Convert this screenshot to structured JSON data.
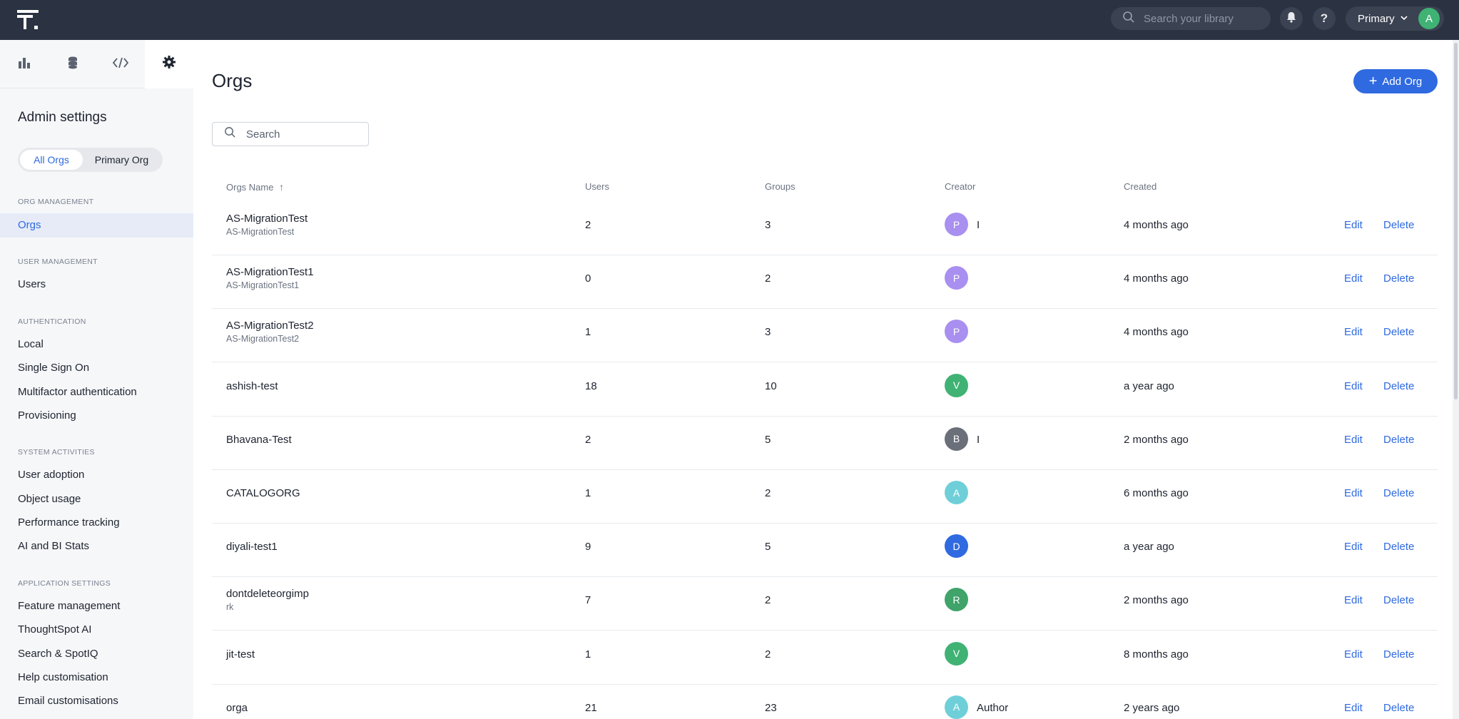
{
  "topbar": {
    "search_placeholder": "Search your library",
    "org_label": "Primary",
    "user_initial": "A",
    "help_label": "?"
  },
  "sidebar": {
    "title": "Admin settings",
    "segment": [
      "All Orgs",
      "Primary Org"
    ],
    "sections": [
      {
        "label": "ORG MANAGEMENT",
        "items": [
          "Orgs"
        ]
      },
      {
        "label": "USER MANAGEMENT",
        "items": [
          "Users"
        ]
      },
      {
        "label": "AUTHENTICATION",
        "items": [
          "Local",
          "Single Sign On",
          "Multifactor authentication",
          "Provisioning"
        ]
      },
      {
        "label": "SYSTEM ACTIVITIES",
        "items": [
          "User adoption",
          "Object usage",
          "Performance tracking",
          "AI and BI Stats"
        ]
      },
      {
        "label": "APPLICATION SETTINGS",
        "items": [
          "Feature management",
          "ThoughtSpot AI",
          "Search & SpotIQ",
          "Help customisation",
          "Email customisations"
        ]
      }
    ]
  },
  "main": {
    "title": "Orgs",
    "add_label": "Add Org",
    "search_placeholder": "Search",
    "columns": [
      "Orgs Name",
      "Users",
      "Groups",
      "Creator",
      "Created"
    ],
    "sort_indicator": "↑",
    "edit_label": "Edit",
    "delete_label": "Delete",
    "rows": [
      {
        "name": "AS-MigrationTest",
        "desc": "AS-MigrationTest",
        "users": "2",
        "groups": "3",
        "initial": "P",
        "color": "#a88ff0",
        "creator": "I",
        "created": "4 months ago"
      },
      {
        "name": "AS-MigrationTest1",
        "desc": "AS-MigrationTest1",
        "users": "0",
        "groups": "2",
        "initial": "P",
        "color": "#a88ff0",
        "creator": "",
        "created": "4 months ago"
      },
      {
        "name": "AS-MigrationTest2",
        "desc": "AS-MigrationTest2",
        "users": "1",
        "groups": "3",
        "initial": "P",
        "color": "#a88ff0",
        "creator": "",
        "created": "4 months ago"
      },
      {
        "name": "ashish-test",
        "desc": "",
        "users": "18",
        "groups": "10",
        "initial": "V",
        "color": "#3fb274",
        "creator": "",
        "created": "a year ago"
      },
      {
        "name": "Bhavana-Test",
        "desc": "",
        "users": "2",
        "groups": "5",
        "initial": "B",
        "color": "#6b6f7a",
        "creator": "I",
        "created": "2 months ago"
      },
      {
        "name": "CATALOGORG",
        "desc": "",
        "users": "1",
        "groups": "2",
        "initial": "A",
        "color": "#6fcfd8",
        "creator": "",
        "created": "6 months ago"
      },
      {
        "name": "diyali-test1",
        "desc": "",
        "users": "9",
        "groups": "5",
        "initial": "D",
        "color": "#2f6ae0",
        "creator": "",
        "created": "a year ago"
      },
      {
        "name": "dontdeleteorgimp",
        "desc": "rk",
        "users": "7",
        "groups": "2",
        "initial": "R",
        "color": "#3fa36a",
        "creator": "",
        "created": "2 months ago"
      },
      {
        "name": "jit-test",
        "desc": "",
        "users": "1",
        "groups": "2",
        "initial": "V",
        "color": "#3fb274",
        "creator": "",
        "created": "8 months ago"
      },
      {
        "name": "orga",
        "desc": "",
        "users": "21",
        "groups": "23",
        "initial": "A",
        "color": "#6fcfd8",
        "creator": "Author",
        "created": "2 years ago"
      }
    ]
  }
}
